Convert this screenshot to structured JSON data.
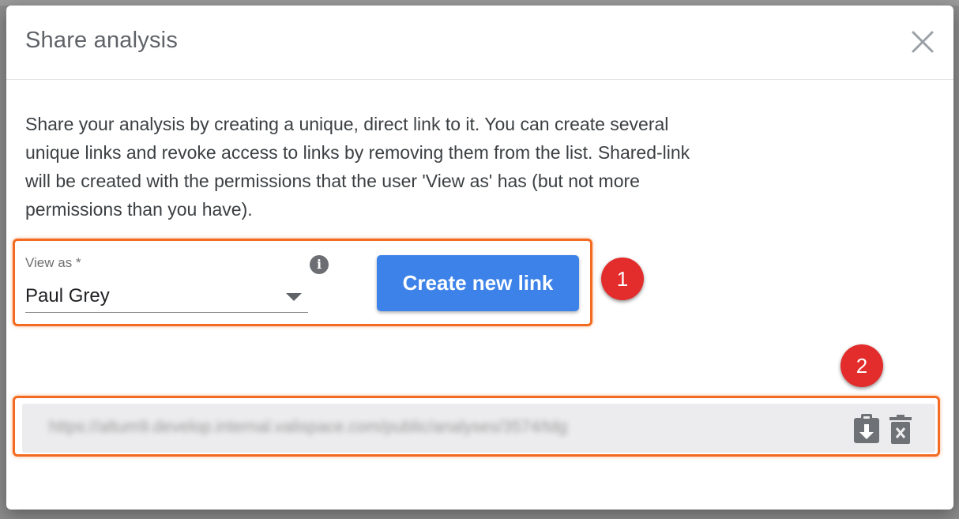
{
  "dialog": {
    "title": "Share analysis",
    "description": "Share your analysis by creating a unique, direct link to it. You can create several unique links and revoke access to links by removing them from the list. Shared-link will be created with the permissions that the user 'View as' has (but not more permissions than you have)."
  },
  "view_as": {
    "label": "View as *",
    "selected": "Paul Grey"
  },
  "create_button": {
    "label": "Create new link"
  },
  "annotations": {
    "badge_1": "1",
    "badge_2": "2"
  },
  "shared_links": [
    {
      "url": "https://altum9.develop.internal.valispace.com/public/analyses/3574/tdg"
    }
  ],
  "colors": {
    "accent": "#3d82e8",
    "annotation_outline": "#f26b21",
    "badge": "#e32c2c"
  },
  "icons": {
    "close": "close-icon",
    "info": "info-icon",
    "copy": "clipboard-copy-icon",
    "delete": "trash-icon"
  }
}
